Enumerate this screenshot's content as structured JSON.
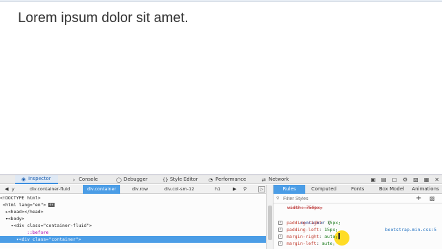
{
  "page": {
    "heading": "Lorem ipsum dolor sit amet."
  },
  "devtools": {
    "tabs": [
      {
        "label": "Inspector",
        "icon": "inspector-icon",
        "active": true
      },
      {
        "label": "Console",
        "icon": "console-icon"
      },
      {
        "label": "Debugger",
        "icon": "debugger-icon"
      },
      {
        "label": "Style Editor",
        "icon": "style-editor-icon"
      },
      {
        "label": "Performance",
        "icon": "performance-icon"
      },
      {
        "label": "Network",
        "icon": "network-icon"
      }
    ],
    "toolbar_icons": [
      "dock-icon",
      "split-icon",
      "responsive-icon",
      "settings-icon",
      "dock-side-icon",
      "popout-icon",
      "close-icon"
    ],
    "breadcrumbs": [
      "y",
      "div.container-fluid",
      "div.container",
      "div.row",
      "div.col-sm-12",
      "h1"
    ],
    "active_breadcrumb": "div.container",
    "tree": {
      "doctype": "<!DOCTYPE html>",
      "html_open": "<html lang=\"en\">",
      "head": "<head></head>",
      "body": "<body>",
      "container_fluid": "<div class=\"container-fluid\">",
      "before": "::before",
      "container": "<div class=\"container\">",
      "event_badge": "ev"
    },
    "rules": {
      "subtabs": [
        "Rules",
        "Computed",
        "Fonts",
        "Box Model",
        "Animations"
      ],
      "active_subtab": "Rules",
      "filter_placeholder": "Filter Styles",
      "add_label": "+",
      "overridden": "width: 750px;",
      "selector": ".container",
      "brace": "{",
      "source": "bootstrap.min.css:5",
      "declarations": [
        {
          "prop": "padding-right",
          "value": "15px;"
        },
        {
          "prop": "padding-left",
          "value": "15px;"
        },
        {
          "prop": "margin-right",
          "value": "auto;"
        },
        {
          "prop": "margin-left",
          "value": "auto;"
        }
      ]
    }
  }
}
